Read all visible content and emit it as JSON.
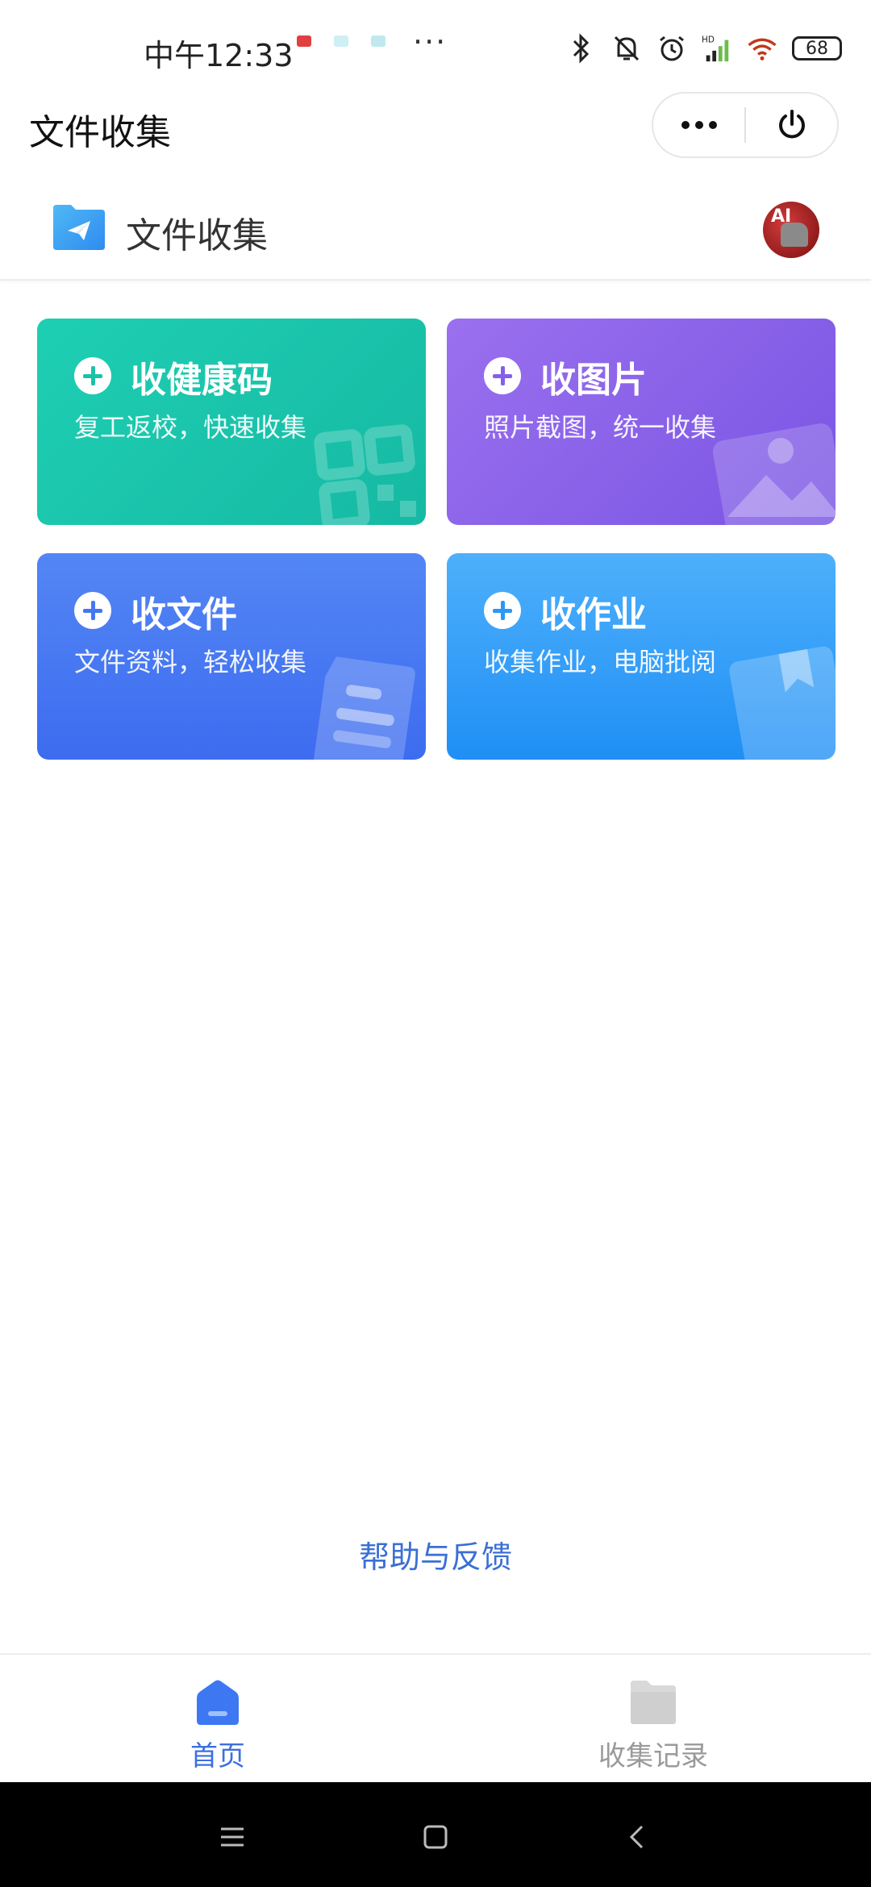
{
  "status_bar": {
    "time": "中午12:33",
    "more": "···",
    "battery": "68",
    "notif_colors": [
      "#e04040",
      "#9adbe8",
      "#5ec8d6"
    ]
  },
  "nav": {
    "title": "文件收集"
  },
  "app_header": {
    "name": "文件收集",
    "avatar_text": "AI"
  },
  "cards": [
    {
      "title": "收健康码",
      "subtitle": "复工返校，快速收集",
      "icon": "qr-code-icon",
      "color": "#1ecfb3"
    },
    {
      "title": "收图片",
      "subtitle": "照片截图，统一收集",
      "icon": "image-icon",
      "color": "#8a63ea"
    },
    {
      "title": "收文件",
      "subtitle": "文件资料，轻松收集",
      "icon": "document-icon",
      "color": "#4a7af3"
    },
    {
      "title": "收作业",
      "subtitle": "收集作业，电脑批阅",
      "icon": "book-icon",
      "color": "#3aa2f8"
    }
  ],
  "help": {
    "label": "帮助与反馈",
    "color": "#3b6fd4"
  },
  "tab_bar": {
    "items": [
      {
        "label": "首页",
        "icon": "home-icon",
        "active": true
      },
      {
        "label": "收集记录",
        "icon": "folder-icon",
        "active": false
      }
    ],
    "active_color": "#3d6fe0",
    "inactive_color": "#9a9a9a"
  },
  "system_nav": {
    "buttons": [
      "menu-icon",
      "home-square-icon",
      "back-icon"
    ]
  }
}
